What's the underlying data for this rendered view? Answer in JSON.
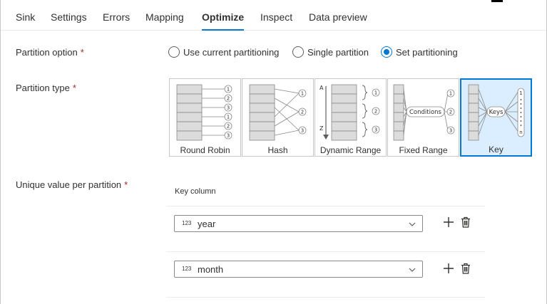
{
  "tabs": [
    {
      "label": "Sink"
    },
    {
      "label": "Settings"
    },
    {
      "label": "Errors"
    },
    {
      "label": "Mapping"
    },
    {
      "label": "Optimize",
      "active": true
    },
    {
      "label": "Inspect"
    },
    {
      "label": "Data preview"
    }
  ],
  "partition_option": {
    "label": "Partition option",
    "required": "*",
    "options": [
      {
        "label": "Use current partitioning",
        "selected": false
      },
      {
        "label": "Single partition",
        "selected": false
      },
      {
        "label": "Set partitioning",
        "selected": true
      }
    ]
  },
  "partition_type": {
    "label": "Partition type",
    "required": "*",
    "cards": [
      {
        "label": "Round Robin",
        "selected": false,
        "nums": [
          "1",
          "2",
          "3",
          "1",
          "2",
          "3"
        ]
      },
      {
        "label": "Hash",
        "selected": false,
        "nums": [
          "1",
          "2",
          "3"
        ]
      },
      {
        "label": "Dynamic Range",
        "selected": false,
        "letters": [
          "A",
          "Z"
        ],
        "nums": [
          "1",
          "2",
          "3"
        ]
      },
      {
        "label": "Fixed Range",
        "selected": false,
        "tag": "Conditions",
        "nums": [
          "1",
          "2",
          "3"
        ]
      },
      {
        "label": "Key",
        "selected": true,
        "tag": "Keys",
        "nums": [
          "1",
          "n"
        ]
      }
    ]
  },
  "unique_value": {
    "label": "Unique value per partition",
    "required": "*",
    "column_header": "Key column",
    "rows": [
      {
        "type": "123",
        "value": "year"
      },
      {
        "type": "123",
        "value": "month"
      }
    ]
  },
  "icons": {
    "add": "plus-icon",
    "delete": "trash-icon",
    "chevron": "chevron-down-icon"
  },
  "colors": {
    "accent": "#0078d4",
    "selected_bg": "#dbeeff",
    "required": "#a4262c"
  }
}
